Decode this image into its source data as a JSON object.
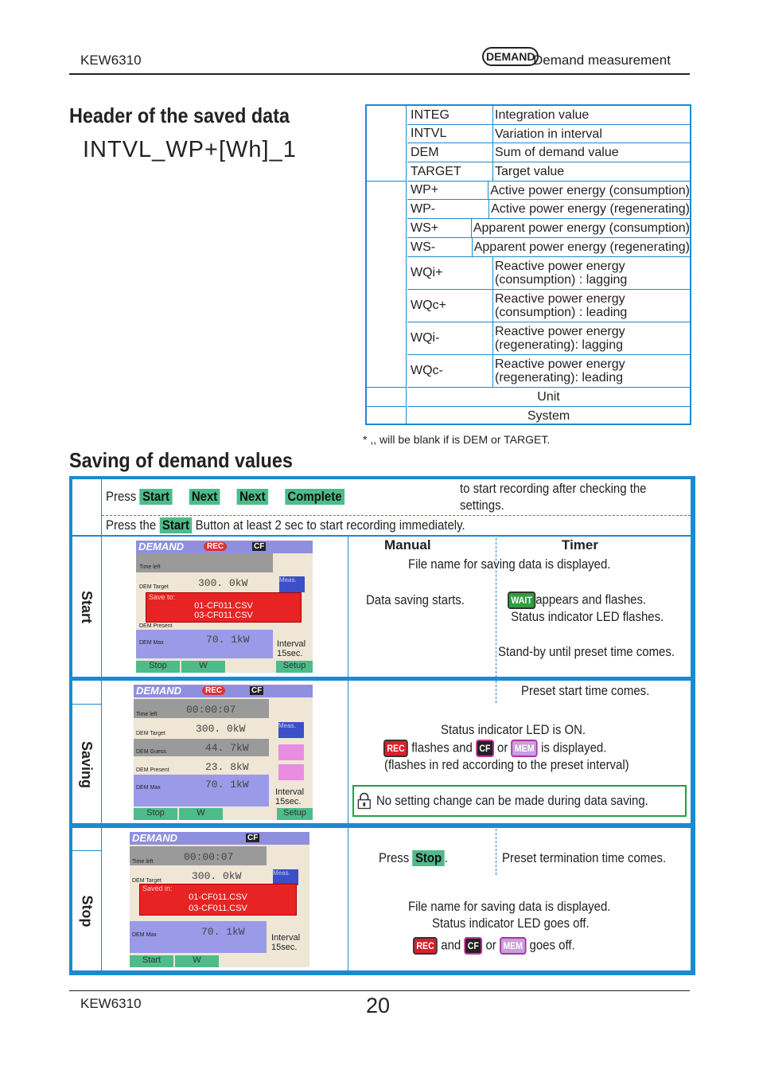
{
  "header": {
    "model": "KEW6310",
    "badge": "DEMAND",
    "section": "Demand measurement"
  },
  "saved_data": {
    "title": "Header of the saved data",
    "example": "INTVL_WP+[Wh]_1",
    "rows": [
      {
        "code": "INTEG",
        "desc": "Integration value"
      },
      {
        "code": "INTVL",
        "desc": "Variation in interval"
      },
      {
        "code": "DEM",
        "desc": "Sum of demand value"
      },
      {
        "code": "TARGET",
        "desc": "Target value"
      },
      {
        "code": "WP+",
        "desc": "Active power energy (consumption)"
      },
      {
        "code": "WP-",
        "desc": "Active power energy (regenerating)"
      },
      {
        "code": "WS+",
        "desc": "Apparent power energy (consumption)"
      },
      {
        "code": "WS-",
        "desc": "Apparent power energy (regenerating)"
      },
      {
        "code": "WQi+",
        "desc": "Reactive power energy",
        "desc2": "(consumption) : lagging"
      },
      {
        "code": "WQc+",
        "desc": "Reactive power energy",
        "desc2": "(consumption) : leading"
      },
      {
        "code": "WQi-",
        "desc": "Reactive power energy",
        "desc2": "(regenerating): lagging"
      },
      {
        "code": "WQc-",
        "desc": "Reactive power energy",
        "desc2": "(regenerating): leading"
      }
    ],
    "unit": "Unit",
    "system": "System",
    "note": "* ,, will be blank if  is DEM or TARGET."
  },
  "saving": {
    "title": "Saving of demand values",
    "intro": {
      "press": "Press",
      "btn_start": "Start",
      "btn_next1": "Next",
      "btn_next2": "Next",
      "btn_complete": "Complete",
      "after": "to start recording after checking the",
      "after2": "settings.",
      "line2_a": "Press the",
      "line2_btn": "Start",
      "line2_b": "Button at least 2 sec to start recording immediately."
    },
    "col_manual": "Manual",
    "col_timer": "Timer",
    "start": {
      "label": "Start",
      "file_name": "File name for saving data is displayed.",
      "manual": "Data saving starts.",
      "wait_icon": "WAIT",
      "timer1": "appears and flashes.",
      "timer2": "Status indicator LED flashes.",
      "timer3": "Stand-by until preset time comes.",
      "screen": {
        "logo": "DEMAND",
        "rec": "REC",
        "cf": "CF",
        "time_left": "Time left",
        "target_label": "DEM Target",
        "target": "300. 0kW",
        "box_title": "Save to:",
        "file1": "01-CF011.CSV",
        "file2": "03-CF011.CSV",
        "present_label": "DEM Present",
        "max_label": "DEM Max",
        "max": "70. 1kW",
        "interval": "Interval",
        "interval_val": "15sec.",
        "meas": "Meas.",
        "b1": "Stop",
        "b2": "W",
        "b3": "Setup"
      }
    },
    "saving": {
      "label": "Saving",
      "timer": "Preset start time comes.",
      "l1": "Status indicator LED is ON.",
      "rec_icon": "REC",
      "l2a": "flashes and",
      "cf_icon": "CF",
      "or": "or",
      "mem_icon": "MEM",
      "l2b": "is displayed.",
      "l3": "(flashes in red according to the preset interval)",
      "lock_note": "No setting change can be made during data saving.",
      "screen": {
        "logo": "DEMAND",
        "rec": "REC",
        "cf": "CF",
        "time_left": "Time left",
        "time": "00:00:07",
        "target_label": "DEM Target",
        "target": "300. 0kW",
        "guess_label": "DEM Guess",
        "guess": "44. 7kW",
        "present_label": "DEM Present",
        "present": "23. 8kW",
        "max_label": "DEM Max",
        "max": "70. 1kW",
        "interval": "Interval",
        "interval_val": "15sec.",
        "meas": "Meas.",
        "b1": "Stop",
        "b2": "W",
        "b3": "Setup"
      }
    },
    "stop": {
      "label": "Stop",
      "press": "Press",
      "btn": "Stop",
      "dot": ".",
      "timer": "Preset termination time comes.",
      "l1": "File name for saving data is displayed.",
      "l2": "Status indicator LED goes off.",
      "rec_icon": "REC",
      "and": "and",
      "cf_icon": "CF",
      "or": "or",
      "mem_icon": "MEM",
      "goes_off": "goes off.",
      "screen": {
        "logo": "DEMAND",
        "cf": "CF",
        "time_left": "Time left",
        "time": "00:00:07",
        "target_label": "DEM Target",
        "target": "300. 0kW",
        "box_title": "Saved in:",
        "file1": "01-CF011.CSV",
        "file2": "03-CF011.CSV",
        "max_label": "DEM Max",
        "max": "70. 1kW",
        "interval": "Interval",
        "interval_val": "15sec.",
        "meas": "Meas.",
        "b1": "Start",
        "b2": "W"
      }
    }
  },
  "footer": {
    "model": "KEW6310",
    "page": "20"
  },
  "colors": {
    "accent_blue": "#1a8ad4",
    "button_green": "#4dbb8a",
    "rec_red": "#e03030",
    "lock_border": "#1aa34a"
  }
}
